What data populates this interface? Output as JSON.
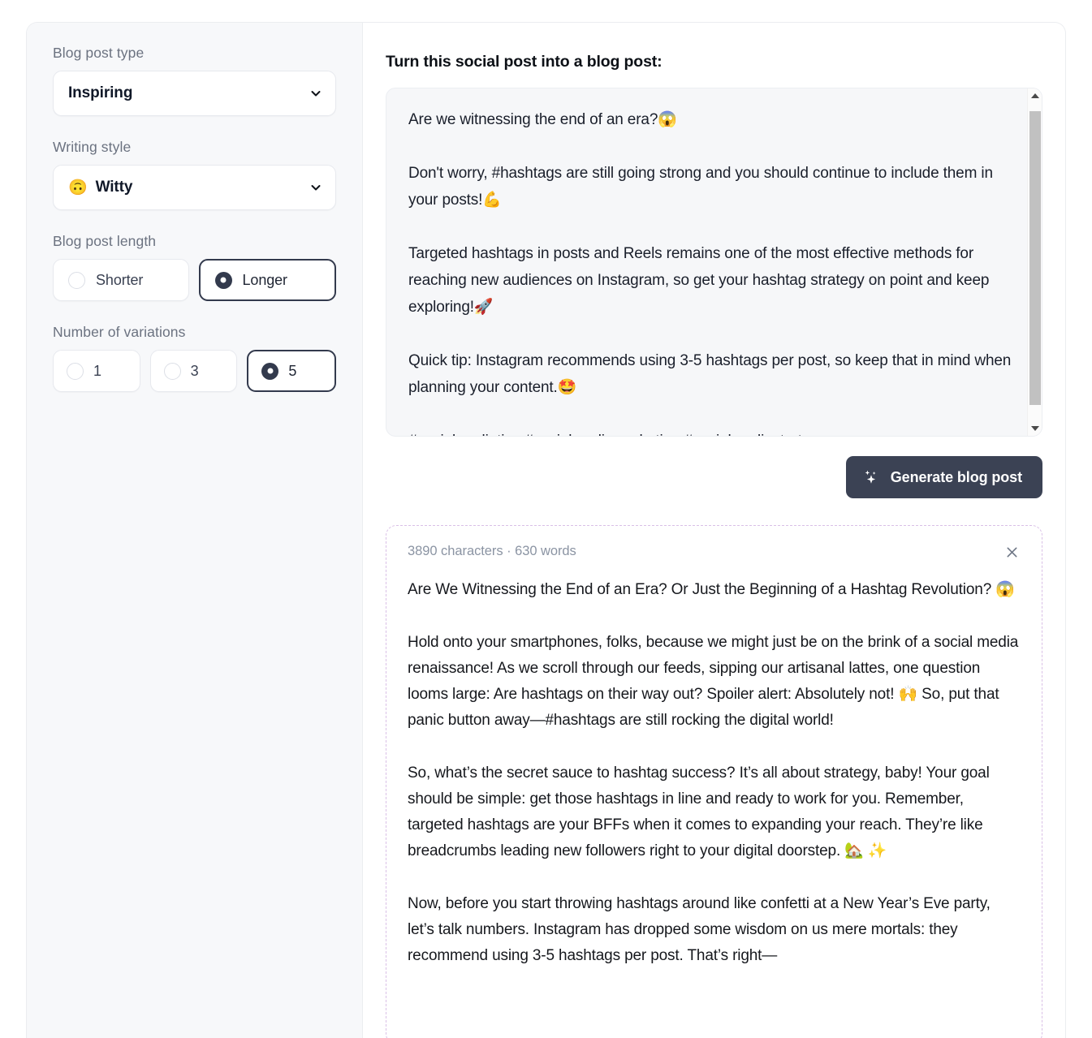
{
  "sidebar": {
    "blog_post_type": {
      "label": "Blog post type",
      "value": "Inspiring",
      "chevron_icon": "chevron-down-icon"
    },
    "writing_style": {
      "label": "Writing style",
      "value": "Witty",
      "emoji": "🙃",
      "chevron_icon": "chevron-down-icon"
    },
    "blog_post_length": {
      "label": "Blog post length",
      "options": [
        {
          "label": "Shorter",
          "selected": false
        },
        {
          "label": "Longer",
          "selected": true
        }
      ]
    },
    "number_of_variations": {
      "label": "Number of variations",
      "options": [
        {
          "label": "1",
          "selected": false
        },
        {
          "label": "3",
          "selected": false
        },
        {
          "label": "5",
          "selected": true
        }
      ]
    }
  },
  "main": {
    "title": "Turn this social post into a blog post:",
    "input": {
      "paragraphs": [
        "Are we witnessing the end of an era?😱",
        "Don't worry, #hashtags are still going strong and you should continue to include them in your posts!💪",
        "Targeted hashtags in posts and Reels remains one of the most effective methods for reaching new audiences on Instagram, so get your hashtag strategy on point and keep exploring!🚀",
        "Quick tip: Instagram recommends using 3-5 hashtags per post, so keep that in mind when planning your content.🤩",
        "#socialmediatips #socialmediamarketing #socialmediastrategy"
      ],
      "scrollbar": {
        "up_icon": "scroll-up-arrow-icon",
        "down_icon": "scroll-down-arrow-icon"
      }
    },
    "generate_button": {
      "label": "Generate blog post",
      "icon": "sparkles-icon"
    },
    "result": {
      "meta": "3890 characters · 630 words",
      "close_icon": "close-icon",
      "paragraphs": [
        "Are We Witnessing the End of an Era? Or Just the Beginning of a Hashtag Revolution? 😱",
        "Hold onto your smartphones, folks, because we might just be on the brink of a social media renaissance! As we scroll through our feeds, sipping our artisanal lattes, one question looms large: Are hashtags on their way out? Spoiler alert: Absolutely not! 🙌 So, put that panic button away—#hashtags are still rocking the digital world!",
        "So, what’s the secret sauce to hashtag success? It’s all about strategy, baby! Your goal should be simple: get those hashtags in line and ready to work for you. Remember, targeted hashtags are your BFFs when it comes to expanding your reach. They’re like breadcrumbs leading new followers right to your digital doorstep. 🏡 ✨",
        "Now, before you start throwing hashtags around like confetti at a New Year’s Eve party, let’s talk numbers. Instagram has dropped some wisdom on us mere mortals: they recommend using 3-5 hashtags per post. That’s right—"
      ]
    }
  },
  "colors": {
    "accent_dark": "#3b4254",
    "sidebar_bg": "#f7f8fa",
    "result_border": "#d9bfe6",
    "muted_text": "#6b7280"
  }
}
